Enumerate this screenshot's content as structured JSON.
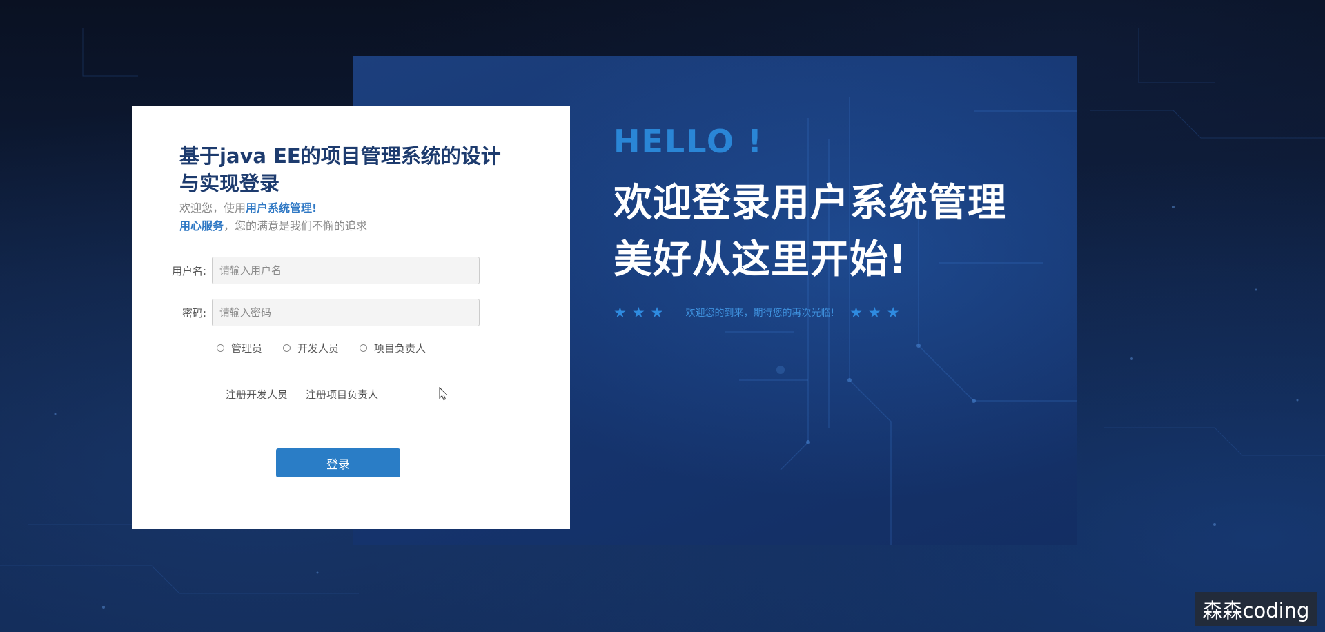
{
  "login": {
    "title": "基于java EE的项目管理系统的设计与实现登录",
    "welcome_prefix": "欢迎您，使用",
    "welcome_highlight": "用户系统管理!",
    "service_highlight": "用心服务",
    "service_suffix": "，您的满意是我们不懈的追求",
    "username_label": "用户名:",
    "username_placeholder": "请输入用户名",
    "password_label": "密码:",
    "password_placeholder": "请输入密码",
    "roles": [
      "管理员",
      "开发人员",
      "项目负责人"
    ],
    "register_developer": "注册开发人员",
    "register_manager": "注册项目负责人",
    "login_button": "登录"
  },
  "hero": {
    "hello": "HELLO !",
    "line1": "欢迎登录用户系统管理",
    "line2": "美好从这里开始!",
    "stars_left": "★★★",
    "tagline": "欢迎您的到来，期待您的再次光临!",
    "stars_right": "★★★"
  },
  "watermark": "森森coding",
  "colors": {
    "accent": "#2a7dc6",
    "title": "#1d3b6e",
    "hello": "#2a86d6",
    "panel": "#163671"
  }
}
